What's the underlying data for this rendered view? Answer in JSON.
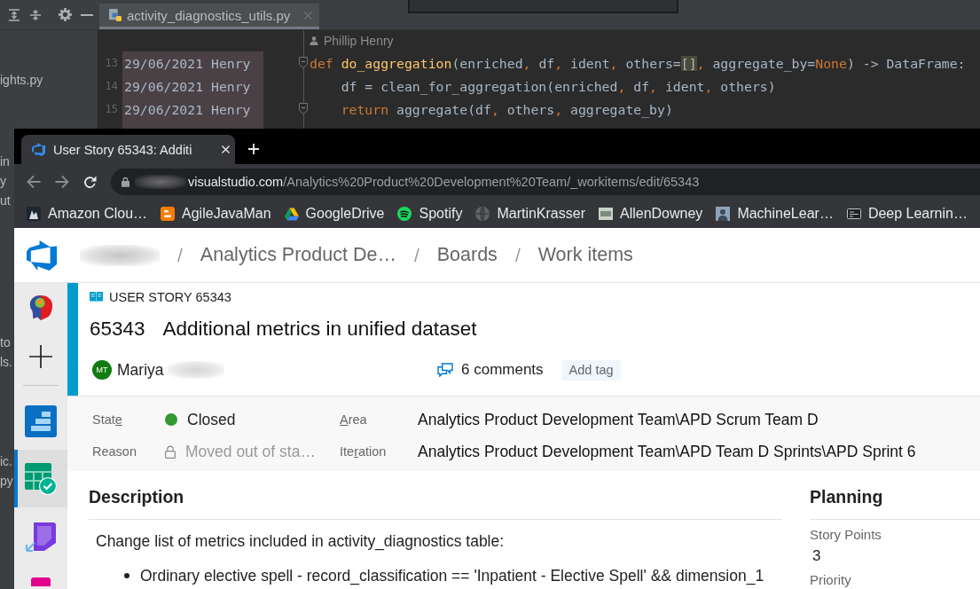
{
  "ide": {
    "tabs": [
      {
        "filename": "activity_diagnostics_utils.py",
        "selected": true
      }
    ],
    "project_panel": {
      "fragments": [
        "ights.py",
        "in",
        "y",
        "ut",
        "to",
        "ls.",
        "ic.",
        "py"
      ]
    },
    "author_hint": "Phillip Henry",
    "lines": [
      {
        "number": "13",
        "blame_date": "29/06/2021",
        "blame_author": "Henry",
        "fold_marker": true,
        "tokens": [
          {
            "kind": "keyword",
            "text": "def"
          },
          {
            "kind": "function",
            "text": " do_aggregation"
          },
          {
            "kind": "plain",
            "text": "(enriched"
          },
          {
            "kind": "comma",
            "text": ","
          },
          {
            "kind": "plain",
            "text": " df"
          },
          {
            "kind": "comma",
            "text": ","
          },
          {
            "kind": "plain",
            "text": " ident"
          },
          {
            "kind": "comma",
            "text": ","
          },
          {
            "kind": "plain",
            "text": " others="
          },
          {
            "kind": "match",
            "text": "[]"
          },
          {
            "kind": "comma",
            "text": ","
          },
          {
            "kind": "plain",
            "text": " aggregate_by="
          },
          {
            "kind": "keyword",
            "text": "None"
          },
          {
            "kind": "plain",
            "text": ") -> DataFrame:"
          }
        ]
      },
      {
        "number": "14",
        "blame_date": "29/06/2021",
        "blame_author": "Henry",
        "fold_marker": false,
        "tokens": [
          {
            "kind": "plain",
            "text": "    df = clean_for_aggregation(enriched"
          },
          {
            "kind": "comma",
            "text": ","
          },
          {
            "kind": "plain",
            "text": " df"
          },
          {
            "kind": "comma",
            "text": ","
          },
          {
            "kind": "plain",
            "text": " ident"
          },
          {
            "kind": "comma",
            "text": ","
          },
          {
            "kind": "plain",
            "text": " others)"
          }
        ]
      },
      {
        "number": "15",
        "blame_date": "29/06/2021",
        "blame_author": "Henry",
        "fold_marker": true,
        "tokens": [
          {
            "kind": "keyword",
            "text": "    return"
          },
          {
            "kind": "plain",
            "text": " aggregate(df"
          },
          {
            "kind": "comma",
            "text": ","
          },
          {
            "kind": "plain",
            "text": " others"
          },
          {
            "kind": "comma",
            "text": ","
          },
          {
            "kind": "plain",
            "text": " aggregate_by)"
          }
        ]
      }
    ]
  },
  "browser": {
    "tabs": [
      {
        "title": "User Story 65343: Additi",
        "selected": true
      }
    ],
    "back": {
      "disabled": true
    },
    "forward": {
      "disabled": true
    },
    "address": {
      "host": "visualstudio.com",
      "path": "/Analytics%20Product%20Development%20Team/_workitems/edit/65343"
    },
    "bookmarks": [
      {
        "kind": "image",
        "label": "Amazon Clou…"
      },
      {
        "kind": "blog",
        "label": "AgileJavaMan"
      },
      {
        "kind": "drive",
        "label": "GoogleDrive"
      },
      {
        "kind": "music",
        "label": "Spotify"
      },
      {
        "kind": "globe",
        "label": "MartinKrasser"
      },
      {
        "kind": "thumbnail",
        "label": "AllenDowney"
      },
      {
        "kind": "photo",
        "label": "MachineLear…"
      },
      {
        "kind": "slides",
        "label": "Deep Learnin…"
      }
    ]
  },
  "page": {
    "breadcrumb": [
      {
        "kind": "separator",
        "text": "/"
      },
      {
        "kind": "link",
        "text": "Analytics Product De…"
      },
      {
        "kind": "separator",
        "text": "/"
      },
      {
        "kind": "link",
        "text": "Boards"
      },
      {
        "kind": "separator",
        "text": "/"
      },
      {
        "kind": "link",
        "text": "Work items"
      }
    ],
    "nav": [
      {
        "kind": "project",
        "selected": false
      },
      {
        "kind": "add",
        "selected": false
      },
      {
        "kind": "overview",
        "selected": false
      },
      {
        "kind": "boards",
        "selected": true
      },
      {
        "kind": "pipelines",
        "selected": false
      },
      {
        "kind": "artifacts",
        "selected": false
      }
    ],
    "work_item": {
      "type_label": "USER STORY 65343",
      "id": "65343",
      "title": "Additional metrics in unified dataset",
      "assignee": {
        "initials": "MT",
        "name": "Mariya"
      },
      "comments": "6 comments",
      "add_tag": "Add tag",
      "fields": [
        {
          "kind": "status",
          "label": {
            "before": "Stat",
            "key": "e"
          },
          "value": "Closed",
          "color": "#339933",
          "disabled": false
        },
        {
          "kind": "path",
          "label": {
            "key": "A",
            "after": "rea"
          },
          "value": "Analytics Product Development Team\\APD Scrum Team D",
          "disabled": false
        },
        {
          "kind": "locked",
          "label": {
            "before": "Reason"
          },
          "value": "Moved out of sta…",
          "disabled": true
        },
        {
          "kind": "path",
          "label": {
            "before": "Ite",
            "key": "r",
            "after": "ation"
          },
          "value": "Analytics Product Development Team\\APD Team D Sprints\\APD Sprint 6",
          "disabled": false
        }
      ],
      "description": {
        "heading": "Description",
        "text": "Change list of metrics included in activity_diagnostics table:",
        "bullets": [
          "Ordinary elective spell - record_classification == 'Inpatient - Elective Spell' && dimension_1"
        ]
      },
      "planning": {
        "heading": "Planning",
        "fields": [
          {
            "label": "Story Points",
            "value": "3"
          },
          {
            "label": "Priority"
          }
        ]
      }
    }
  }
}
